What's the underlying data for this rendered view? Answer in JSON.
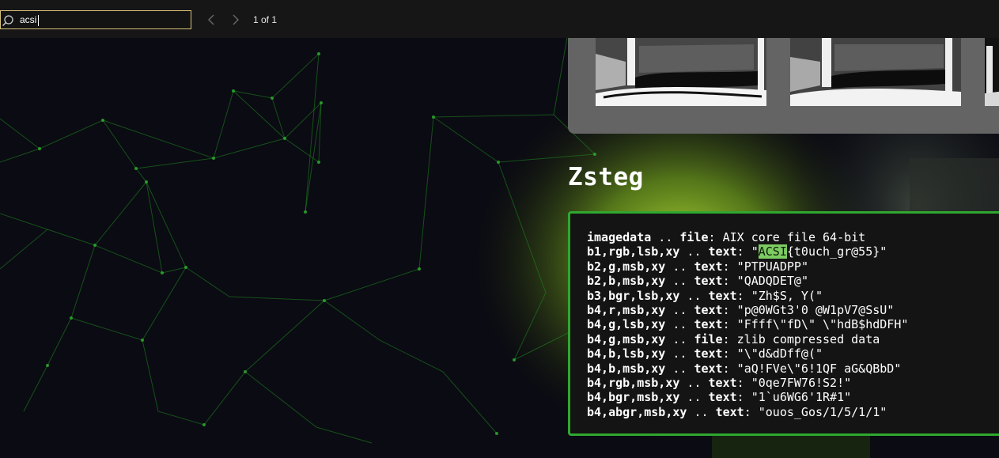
{
  "find_bar": {
    "query": "acsi",
    "match_count": "1 of 1",
    "search_icon": "magnifier-icon",
    "prev_icon": "chevron-left-icon",
    "next_icon": "chevron-right-icon"
  },
  "section": {
    "title": "Zsteg"
  },
  "zsteg_output": [
    {
      "key": "imagedata",
      "kind": "file",
      "value": "AIX core file 64-bit",
      "quoted": false
    },
    {
      "key": "b1,rgb,lsb,xy",
      "kind": "text",
      "value_highlight": "ACSI",
      "value": "{t0uch_gr@55}",
      "quoted": true
    },
    {
      "key": "b2,g,msb,xy",
      "kind": "text",
      "value": "PTPUADPP",
      "quoted": true
    },
    {
      "key": "b2,b,msb,xy",
      "kind": "text",
      "value": "QADQDET@",
      "quoted": true
    },
    {
      "key": "b3,bgr,lsb,xy",
      "kind": "text",
      "value": "Zh$S, Y(",
      "quoted": true
    },
    {
      "key": "b4,r,msb,xy",
      "kind": "text",
      "value": "p@0WGt3'0 @W1pV7@SsU",
      "quoted": true
    },
    {
      "key": "b4,g,lsb,xy",
      "kind": "text",
      "value": "Ffff\\\"fD\\\" \\\"hdB$hdDFH",
      "quoted": true
    },
    {
      "key": "b4,g,msb,xy",
      "kind": "file",
      "value": "zlib compressed data",
      "quoted": false
    },
    {
      "key": "b4,b,lsb,xy",
      "kind": "text",
      "value": "\\\"d&dDff@(",
      "quoted": true
    },
    {
      "key": "b4,b,msb,xy",
      "kind": "text",
      "value": "aQ!FVe\\\"6!1QF aG&QBbD",
      "quoted": true
    },
    {
      "key": "b4,rgb,msb,xy",
      "kind": "text",
      "value": "0qe7FW76!S2!",
      "quoted": true
    },
    {
      "key": "b4,bgr,msb,xy",
      "kind": "text",
      "value": "1`u6WG6'1R#1",
      "quoted": true
    },
    {
      "key": "b4,abgr,msb,xy",
      "kind": "text",
      "value": "ouos_Gos/1/5/1/1",
      "quoted": true
    }
  ],
  "colors": {
    "accent_green": "#2fa82f",
    "highlight": "#7dcc62",
    "find_border": "#d8c27a"
  }
}
